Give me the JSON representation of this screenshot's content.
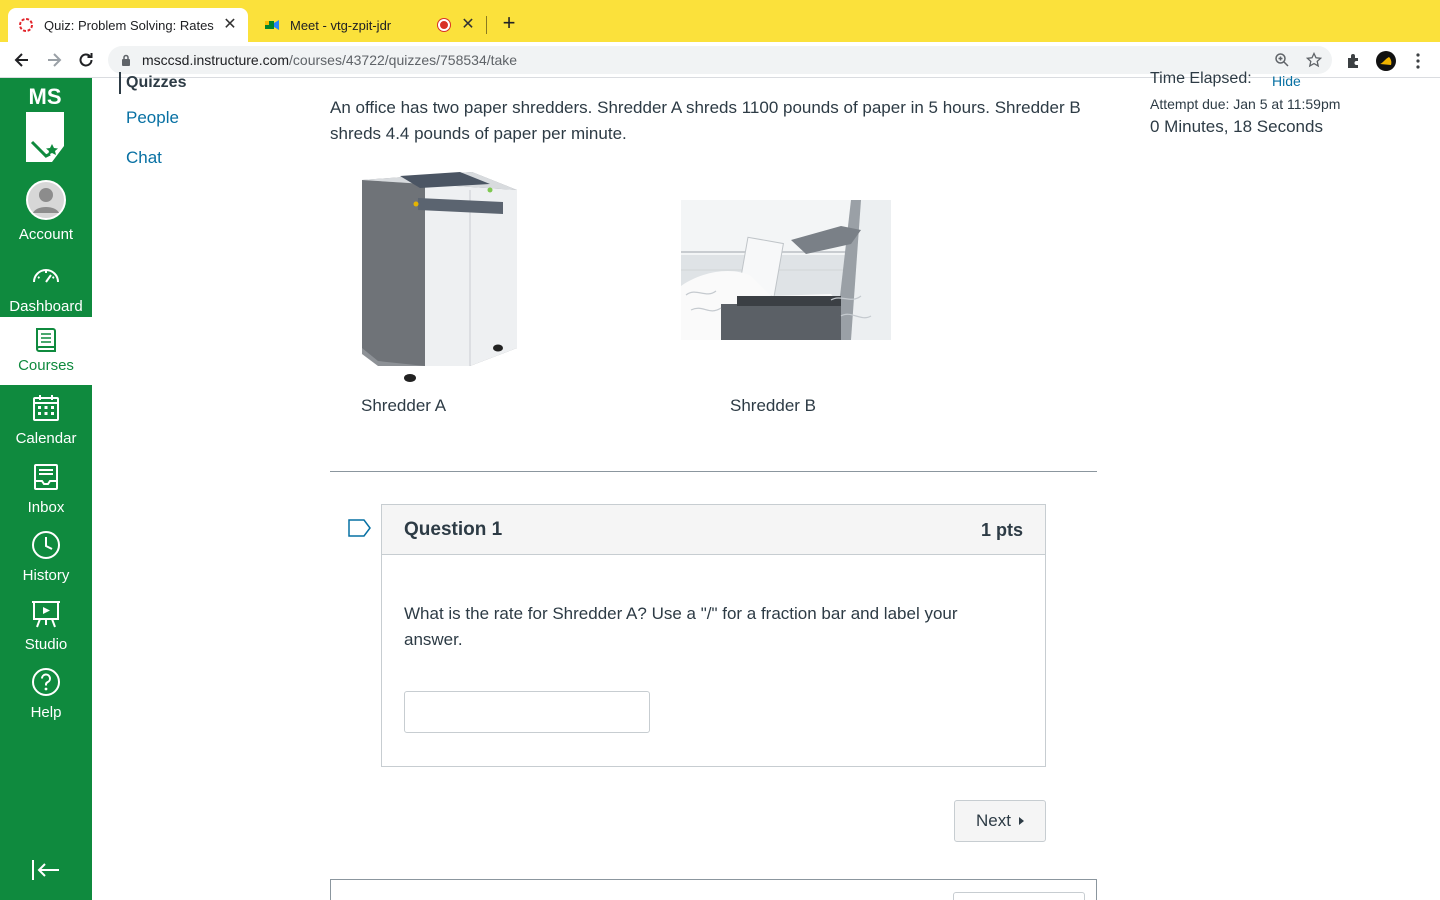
{
  "browser": {
    "tabs": [
      {
        "title": "Quiz: Problem Solving: Rates",
        "active": true
      },
      {
        "title": "Meet - vtg-zpit-jdr",
        "active": false
      }
    ],
    "url_host": "msccsd.instructure.com",
    "url_path": "/courses/43722/quizzes/758534/take"
  },
  "global_nav": {
    "logo_text": "MS",
    "items": [
      {
        "label": "Account",
        "icon": "account-icon"
      },
      {
        "label": "Dashboard",
        "icon": "dashboard-icon"
      },
      {
        "label": "Courses",
        "icon": "courses-icon",
        "active": true
      },
      {
        "label": "Calendar",
        "icon": "calendar-icon"
      },
      {
        "label": "Inbox",
        "icon": "inbox-icon"
      },
      {
        "label": "History",
        "icon": "history-icon"
      },
      {
        "label": "Studio",
        "icon": "studio-icon"
      },
      {
        "label": "Help",
        "icon": "help-icon"
      }
    ],
    "colors": {
      "background": "#0f8a3e",
      "text": "#ffffff"
    }
  },
  "course_nav": {
    "active": "Quizzes",
    "links": [
      "People",
      "Chat"
    ]
  },
  "quiz": {
    "intro": "An office has two paper shredders.  Shredder A shreds 1100 pounds of paper in 5 hours.  Shredder B shreds 4.4 pounds of paper per minute.",
    "caption_a": "Shredder A",
    "caption_b": "Shredder B",
    "question": {
      "title": "Question 1",
      "points": "1 pts",
      "text": "What is the rate for Shredder A? Use a \"/\" for a fraction bar and label your answer.",
      "answer_value": ""
    },
    "next_label": "Next"
  },
  "sidebar": {
    "time_elapsed_label": "Time Elapsed:",
    "hide_label": "Hide",
    "attempt_due": "Attempt due: Jan 5 at 11:59pm",
    "elapsed": "0 Minutes, 18 Seconds"
  }
}
